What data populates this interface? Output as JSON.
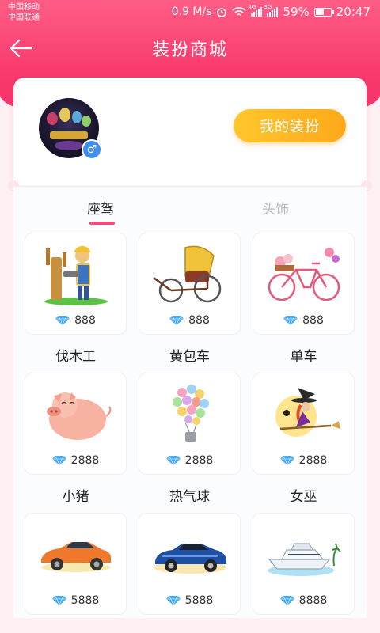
{
  "status_bar": {
    "carrier1": "中国移动",
    "carrier2": "中国联通",
    "speed": "0.9 M/s",
    "signal1_tag": "4G",
    "signal2_tag": "3G",
    "battery": "59%",
    "battery_level": 0.59,
    "time": "20:47"
  },
  "nav": {
    "title": "装扮商城"
  },
  "profile": {
    "gender_symbol": "♂",
    "my_dress_label": "我的装扮"
  },
  "tabs": [
    {
      "label": "座驾",
      "active": true
    },
    {
      "label": "头饰",
      "active": false
    }
  ],
  "items": [
    {
      "name": "伐木工",
      "price": "888",
      "icon": "lumberjack-icon"
    },
    {
      "name": "黄包车",
      "price": "888",
      "icon": "rickshaw-icon"
    },
    {
      "name": "单车",
      "price": "888",
      "icon": "bicycle-icon"
    },
    {
      "name": "小猪",
      "price": "2888",
      "icon": "pig-icon"
    },
    {
      "name": "热气球",
      "price": "2888",
      "icon": "balloon-icon"
    },
    {
      "name": "女巫",
      "price": "2888",
      "icon": "witch-icon"
    },
    {
      "name": "",
      "price": "5888",
      "icon": "orange-sports-car-icon"
    },
    {
      "name": "",
      "price": "5888",
      "icon": "blue-supercar-icon"
    },
    {
      "name": "",
      "price": "8888",
      "icon": "yacht-icon"
    }
  ],
  "colors": {
    "accent": "#f4336a",
    "button": "#fdb022",
    "tab_active": "#f34a77",
    "gender": "#3f8df0"
  }
}
